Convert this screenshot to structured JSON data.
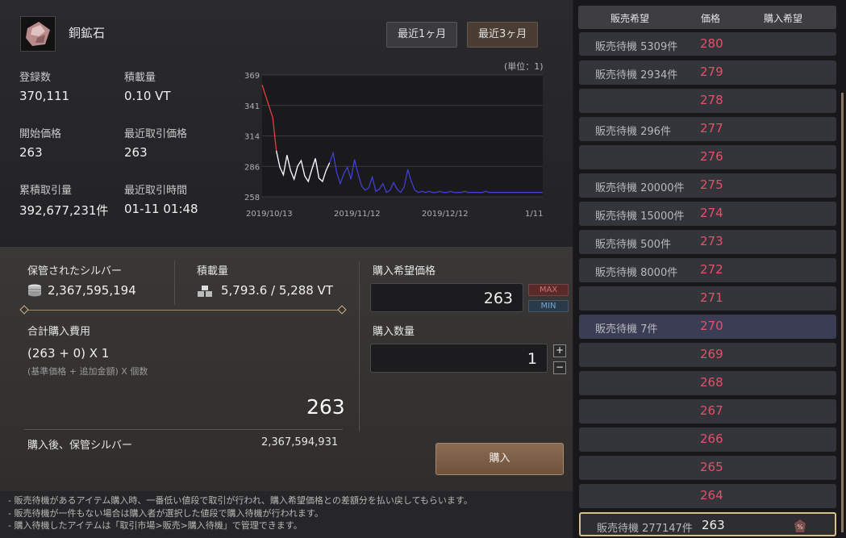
{
  "item": {
    "name": "銅鉱石",
    "icon": "copper-ore-icon"
  },
  "time_buttons": [
    "最近1ヶ月",
    "最近3ヶ月"
  ],
  "stats": [
    {
      "label": "登録数",
      "value": "370,111"
    },
    {
      "label": "積載量",
      "value": "0.10 VT"
    },
    {
      "label": "開始価格",
      "value": "263"
    },
    {
      "label": "最近取引価格",
      "value": "263"
    },
    {
      "label": "累積取引量",
      "value": "392,677,231件"
    },
    {
      "label": "最近取引時間",
      "value": "01-11 01:48"
    }
  ],
  "chart_data": {
    "type": "line",
    "unit_label": "(単位：1)",
    "yticks": [
      "369",
      "341",
      "314",
      "286",
      "258"
    ],
    "xticks": [
      "2019/10/13",
      "2019/11/12",
      "2019/12/12",
      "1/11"
    ],
    "ylim": [
      258,
      369
    ],
    "values": [
      360,
      350,
      340,
      330,
      300,
      285,
      278,
      296,
      282,
      274,
      286,
      291,
      277,
      272,
      283,
      293,
      275,
      272,
      282,
      289,
      298,
      280,
      270,
      279,
      285,
      274,
      292,
      279,
      268,
      264,
      266,
      276,
      263,
      265,
      270,
      262,
      264,
      271,
      265,
      262,
      267,
      283,
      272,
      264,
      262,
      263,
      262,
      263,
      262,
      262,
      263,
      262,
      262,
      263,
      262,
      262,
      262,
      263,
      262,
      262,
      262,
      262,
      262,
      263,
      262,
      262,
      262,
      262,
      262,
      262,
      262,
      262,
      262,
      262,
      262,
      262,
      262,
      262,
      262,
      262
    ],
    "colors": {
      "recent": "#e04040",
      "line": "#4040d0",
      "highlight": "#ffffff"
    }
  },
  "storage": {
    "label": "保管されたシルバー",
    "value": "2,367,595,194",
    "icon": "silver-coins-icon"
  },
  "weight": {
    "label": "積載量",
    "value": "5,793.6 / 5,288 VT",
    "icon": "weight-icon"
  },
  "cost": {
    "label": "合計購入費用",
    "formula": "(263 + 0) X 1",
    "formula_note": "(基準価格 + 追加金額) X 個数",
    "total": "263",
    "after_label": "購入後、保管シルバー",
    "after_value": "2,367,594,931"
  },
  "buy_price": {
    "label": "購入希望価格",
    "value": "263",
    "max": "MAX",
    "min": "MIN"
  },
  "buy_qty": {
    "label": "購入数量",
    "value": "1",
    "plus": "+",
    "minus": "−"
  },
  "buy_button": "購入",
  "notes": [
    "- 販売待機があるアイテム購入時、一番低い値段で取引が行われ、購入希望価格との差額分を払い戻してもらいます。",
    "- 販売待機が一件もない場合は購入者が選択した値段で購入待機が行われます。",
    "- 購入待機したアイテムは「取引市場>販売>購入待機」で管理できます。"
  ],
  "orderbook": {
    "headers": [
      "販売希望",
      "価格",
      "購入希望"
    ],
    "rows": [
      {
        "wait": "販売待機 5309件",
        "price": "280"
      },
      {
        "wait": "販売待機 2934件",
        "price": "279"
      },
      {
        "wait": "",
        "price": "278"
      },
      {
        "wait": "販売待機 296件",
        "price": "277"
      },
      {
        "wait": "",
        "price": "276"
      },
      {
        "wait": "販売待機 20000件",
        "price": "275"
      },
      {
        "wait": "販売待機 15000件",
        "price": "274"
      },
      {
        "wait": "販売待機 500件",
        "price": "273"
      },
      {
        "wait": "販売待機 8000件",
        "price": "272"
      },
      {
        "wait": "",
        "price": "271"
      },
      {
        "wait": "販売待機 7件",
        "price": "270"
      },
      {
        "wait": "",
        "price": "269"
      },
      {
        "wait": "",
        "price": "268"
      },
      {
        "wait": "",
        "price": "267"
      },
      {
        "wait": "",
        "price": "266"
      },
      {
        "wait": "",
        "price": "265"
      },
      {
        "wait": "",
        "price": "264"
      },
      {
        "wait": "販売待機 277147件",
        "price": "263"
      }
    ]
  }
}
